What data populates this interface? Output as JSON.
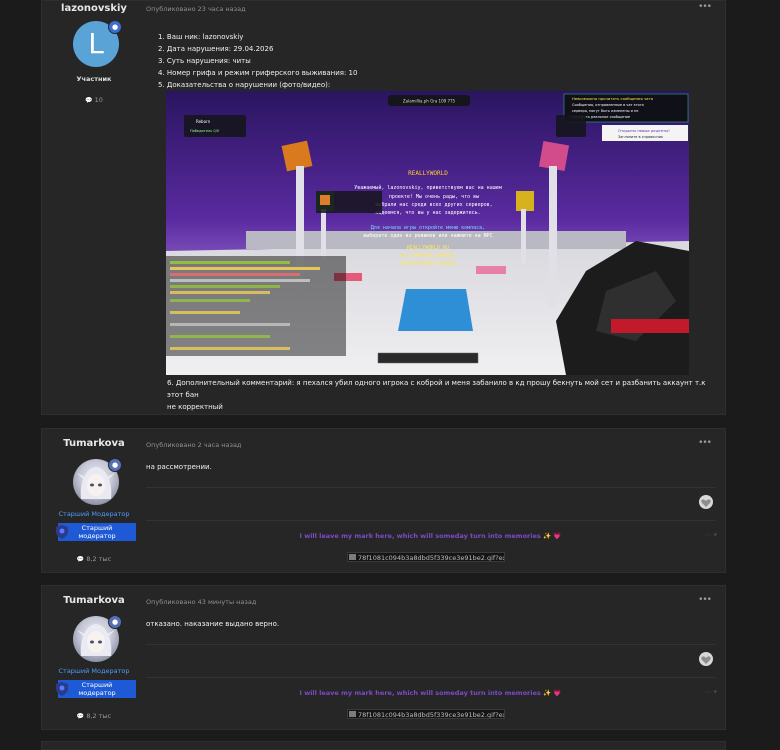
{
  "posts": [
    {
      "author": "lazonovskiy",
      "avatar_letter": "L",
      "role": "Участник",
      "reputation": "10",
      "meta": "Опубликовано 23 часа назад",
      "content_lines": [
        "1. Ваш ник: lazonovskiy",
        "2. Дата нарушения: 29.04.2026",
        "3. Суть нарушения: читы",
        "4. Номер грифа и режим гриферского выживания: 10",
        "5. Доказательства о нарушении (фото/видео):"
      ],
      "comment_line1": "6. Дополнительный комментарий: я пехался убил одного игрока с коброй и меня забанило в кд прошу бекнуть мой сет и разбанить аккаунт т.к этот бан",
      "comment_line2": "не корректный"
    },
    {
      "author": "Tumarkova",
      "role": "Старший Модератор",
      "role_badge_line1": "Старший",
      "role_badge_line2": "модератор",
      "reputation": "8,2 тыс",
      "meta": "Опубликовано 2 часа назад",
      "content": "на рассмотрении.",
      "signature": "I will leave my mark here, which will someday turn into memories ✨ 💗",
      "signature_image": "78f1081c094b3a8dbd5f339ce3e91be2.gif?ex="
    },
    {
      "author": "Tumarkova",
      "role": "Старший Модератор",
      "role_badge_line1": "Старший",
      "role_badge_line2": "модератор",
      "reputation": "8,2 тыс",
      "meta": "Опубликовано 43 минуты назад",
      "content": "отказано. наказание выдано верно.",
      "signature": "I will leave my mark here, which will someday turn into memories ✨ 💗",
      "signature_image": "78f1081c094b3a8dbd5f339ce3e91be2.gif?ex="
    }
  ],
  "ui": {
    "more_glyph": "•••",
    "rep_icon": "💬",
    "sig_dots": "⋯ ▾"
  },
  "screenshot": {
    "top_pill": "Zalamillia.ph   Gra   109 775",
    "notice_title": "REALLYWORLD",
    "notice_lines": [
      "Уважаемый, lazonovskiy, приветствуем вас на нашем",
      "проекте! Мы очень рады, что вы",
      "выбрали нас среди всех других серверов,",
      "надеемся, что вы у нас задержитесь.",
      "Для начала игры откройте меню компаса,",
      "выберите один из режимов или нажмите на NPC"
    ],
    "right_box1_line1": "Невозможно прочитать сообщения чата",
    "right_box1_line2": "Сообщения, отправленные в чат этого",
    "right_box1_line3": "сервера, могут быть изменены и не",
    "right_box1_line4": "отражать реальное сообщение",
    "right_box2_line1": "Открыты новые рецепты!",
    "right_box2_line2": "Загляните в справочник",
    "left_panel_title": "Reborn",
    "left_panel_line": "Победитель  0/0",
    "sign_lines": [
      "REALLYWORLD.RU",
      "VK.COM/REALLYWORLD",
      "YOUTUBE/REALLYWORLD"
    ]
  }
}
